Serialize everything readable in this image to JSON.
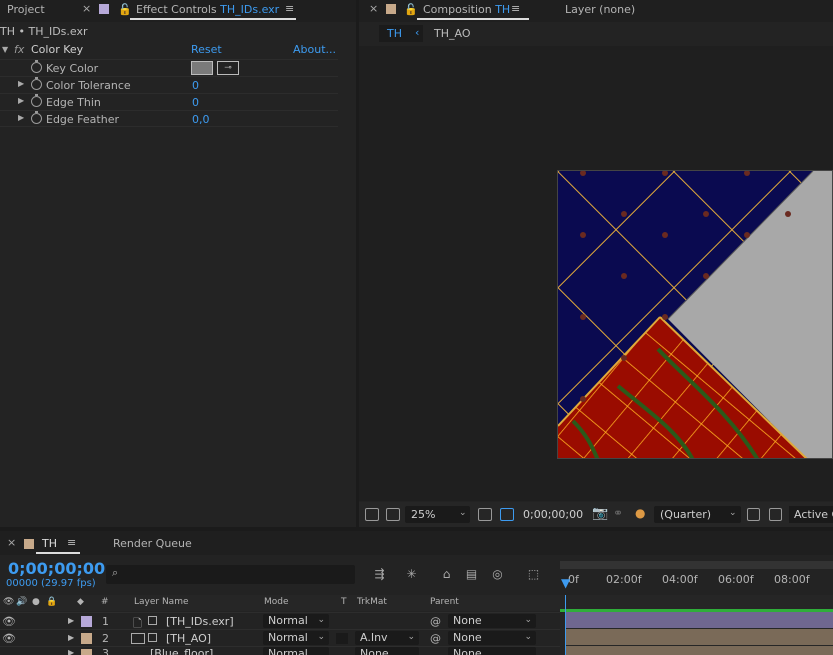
{
  "project_panel": {
    "title": "Project"
  },
  "effect_controls": {
    "tab_prefix": "Effect Controls",
    "tab_file": "TH_IDs.exr",
    "header": "TH • TH_IDs.exr",
    "effect": {
      "name": "Color Key",
      "fx_label": "fx",
      "reset": "Reset",
      "about": "About..."
    },
    "properties": [
      {
        "name": "Key Color",
        "value": ""
      },
      {
        "name": "Color Tolerance",
        "value": "0"
      },
      {
        "name": "Edge Thin",
        "value": "0"
      },
      {
        "name": "Edge Feather",
        "value": "0,0"
      }
    ],
    "colors": {
      "key_color": "#7a7a7a",
      "value_blue": "#3d9bf0"
    }
  },
  "composition": {
    "tab_prefix": "Composition",
    "tab_name": "TH",
    "layer_tab": "Layer (none)",
    "breadcrumbs": [
      "TH",
      "TH_AO"
    ],
    "zoom": "25%",
    "timecode": "0;00;00;00",
    "resolution": "(Quarter)",
    "view": "Active C"
  },
  "timeline": {
    "tab": "TH",
    "render_queue": "Render Queue",
    "timecode": "0;00;00;00",
    "fps_label": "00000 (29.97 fps)",
    "columns": {
      "number": "#",
      "layer_name": "Layer Name",
      "mode": "Mode",
      "t": "T",
      "trkmat": "TrkMat",
      "parent": "Parent"
    },
    "ruler": [
      "0f",
      "02:00f",
      "04:00f",
      "06:00f",
      "08:00f"
    ],
    "layers": [
      {
        "num": "1",
        "name": "[TH_IDs.exr]",
        "mode": "Normal",
        "trkmat": "",
        "parent": "None",
        "label_color": "#b7a9d9"
      },
      {
        "num": "2",
        "name": "[TH_AO]",
        "mode": "Normal",
        "trkmat": "A.Inv",
        "parent": "None",
        "label_color": "#c7a98a"
      },
      {
        "num": "3",
        "name": "[Blue_floor]",
        "mode": "Normal",
        "trkmat": "None",
        "parent": "None",
        "label_color": "#c7a98a"
      }
    ]
  }
}
